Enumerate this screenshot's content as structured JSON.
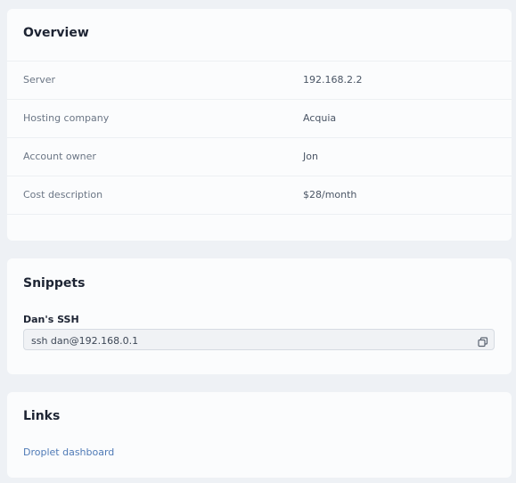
{
  "overview": {
    "title": "Overview",
    "rows": [
      {
        "label": "Server",
        "value": "192.168.2.2"
      },
      {
        "label": "Hosting company",
        "value": "Acquia"
      },
      {
        "label": "Account owner",
        "value": "Jon"
      },
      {
        "label": "Cost description",
        "value": "$28/month"
      }
    ]
  },
  "snippets": {
    "title": "Snippets",
    "items": [
      {
        "label": "Dan's SSH",
        "value": "ssh dan@192.168.0.1",
        "icon": "copy-icon"
      }
    ]
  },
  "links": {
    "title": "Links",
    "items": [
      {
        "label": "Droplet dashboard"
      }
    ]
  },
  "colors": {
    "page_background": "#eef1f5",
    "card_background": "#fbfcfd",
    "link": "#4f7ab6"
  }
}
